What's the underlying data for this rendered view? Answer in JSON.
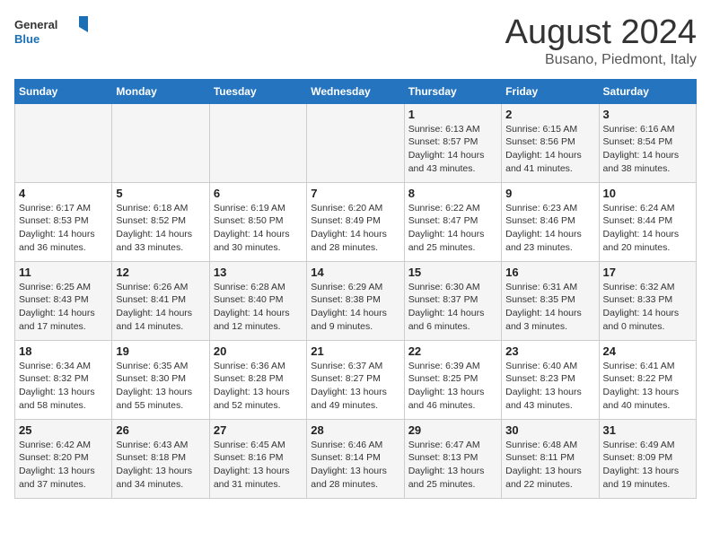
{
  "header": {
    "logo_line1": "General",
    "logo_line2": "Blue",
    "month": "August 2024",
    "location": "Busano, Piedmont, Italy"
  },
  "days_of_week": [
    "Sunday",
    "Monday",
    "Tuesday",
    "Wednesday",
    "Thursday",
    "Friday",
    "Saturday"
  ],
  "weeks": [
    [
      {
        "day": "",
        "info": ""
      },
      {
        "day": "",
        "info": ""
      },
      {
        "day": "",
        "info": ""
      },
      {
        "day": "",
        "info": ""
      },
      {
        "day": "1",
        "info": "Sunrise: 6:13 AM\nSunset: 8:57 PM\nDaylight: 14 hours and 43 minutes."
      },
      {
        "day": "2",
        "info": "Sunrise: 6:15 AM\nSunset: 8:56 PM\nDaylight: 14 hours and 41 minutes."
      },
      {
        "day": "3",
        "info": "Sunrise: 6:16 AM\nSunset: 8:54 PM\nDaylight: 14 hours and 38 minutes."
      }
    ],
    [
      {
        "day": "4",
        "info": "Sunrise: 6:17 AM\nSunset: 8:53 PM\nDaylight: 14 hours and 36 minutes."
      },
      {
        "day": "5",
        "info": "Sunrise: 6:18 AM\nSunset: 8:52 PM\nDaylight: 14 hours and 33 minutes."
      },
      {
        "day": "6",
        "info": "Sunrise: 6:19 AM\nSunset: 8:50 PM\nDaylight: 14 hours and 30 minutes."
      },
      {
        "day": "7",
        "info": "Sunrise: 6:20 AM\nSunset: 8:49 PM\nDaylight: 14 hours and 28 minutes."
      },
      {
        "day": "8",
        "info": "Sunrise: 6:22 AM\nSunset: 8:47 PM\nDaylight: 14 hours and 25 minutes."
      },
      {
        "day": "9",
        "info": "Sunrise: 6:23 AM\nSunset: 8:46 PM\nDaylight: 14 hours and 23 minutes."
      },
      {
        "day": "10",
        "info": "Sunrise: 6:24 AM\nSunset: 8:44 PM\nDaylight: 14 hours and 20 minutes."
      }
    ],
    [
      {
        "day": "11",
        "info": "Sunrise: 6:25 AM\nSunset: 8:43 PM\nDaylight: 14 hours and 17 minutes."
      },
      {
        "day": "12",
        "info": "Sunrise: 6:26 AM\nSunset: 8:41 PM\nDaylight: 14 hours and 14 minutes."
      },
      {
        "day": "13",
        "info": "Sunrise: 6:28 AM\nSunset: 8:40 PM\nDaylight: 14 hours and 12 minutes."
      },
      {
        "day": "14",
        "info": "Sunrise: 6:29 AM\nSunset: 8:38 PM\nDaylight: 14 hours and 9 minutes."
      },
      {
        "day": "15",
        "info": "Sunrise: 6:30 AM\nSunset: 8:37 PM\nDaylight: 14 hours and 6 minutes."
      },
      {
        "day": "16",
        "info": "Sunrise: 6:31 AM\nSunset: 8:35 PM\nDaylight: 14 hours and 3 minutes."
      },
      {
        "day": "17",
        "info": "Sunrise: 6:32 AM\nSunset: 8:33 PM\nDaylight: 14 hours and 0 minutes."
      }
    ],
    [
      {
        "day": "18",
        "info": "Sunrise: 6:34 AM\nSunset: 8:32 PM\nDaylight: 13 hours and 58 minutes."
      },
      {
        "day": "19",
        "info": "Sunrise: 6:35 AM\nSunset: 8:30 PM\nDaylight: 13 hours and 55 minutes."
      },
      {
        "day": "20",
        "info": "Sunrise: 6:36 AM\nSunset: 8:28 PM\nDaylight: 13 hours and 52 minutes."
      },
      {
        "day": "21",
        "info": "Sunrise: 6:37 AM\nSunset: 8:27 PM\nDaylight: 13 hours and 49 minutes."
      },
      {
        "day": "22",
        "info": "Sunrise: 6:39 AM\nSunset: 8:25 PM\nDaylight: 13 hours and 46 minutes."
      },
      {
        "day": "23",
        "info": "Sunrise: 6:40 AM\nSunset: 8:23 PM\nDaylight: 13 hours and 43 minutes."
      },
      {
        "day": "24",
        "info": "Sunrise: 6:41 AM\nSunset: 8:22 PM\nDaylight: 13 hours and 40 minutes."
      }
    ],
    [
      {
        "day": "25",
        "info": "Sunrise: 6:42 AM\nSunset: 8:20 PM\nDaylight: 13 hours and 37 minutes."
      },
      {
        "day": "26",
        "info": "Sunrise: 6:43 AM\nSunset: 8:18 PM\nDaylight: 13 hours and 34 minutes."
      },
      {
        "day": "27",
        "info": "Sunrise: 6:45 AM\nSunset: 8:16 PM\nDaylight: 13 hours and 31 minutes."
      },
      {
        "day": "28",
        "info": "Sunrise: 6:46 AM\nSunset: 8:14 PM\nDaylight: 13 hours and 28 minutes."
      },
      {
        "day": "29",
        "info": "Sunrise: 6:47 AM\nSunset: 8:13 PM\nDaylight: 13 hours and 25 minutes."
      },
      {
        "day": "30",
        "info": "Sunrise: 6:48 AM\nSunset: 8:11 PM\nDaylight: 13 hours and 22 minutes."
      },
      {
        "day": "31",
        "info": "Sunrise: 6:49 AM\nSunset: 8:09 PM\nDaylight: 13 hours and 19 minutes."
      }
    ]
  ]
}
